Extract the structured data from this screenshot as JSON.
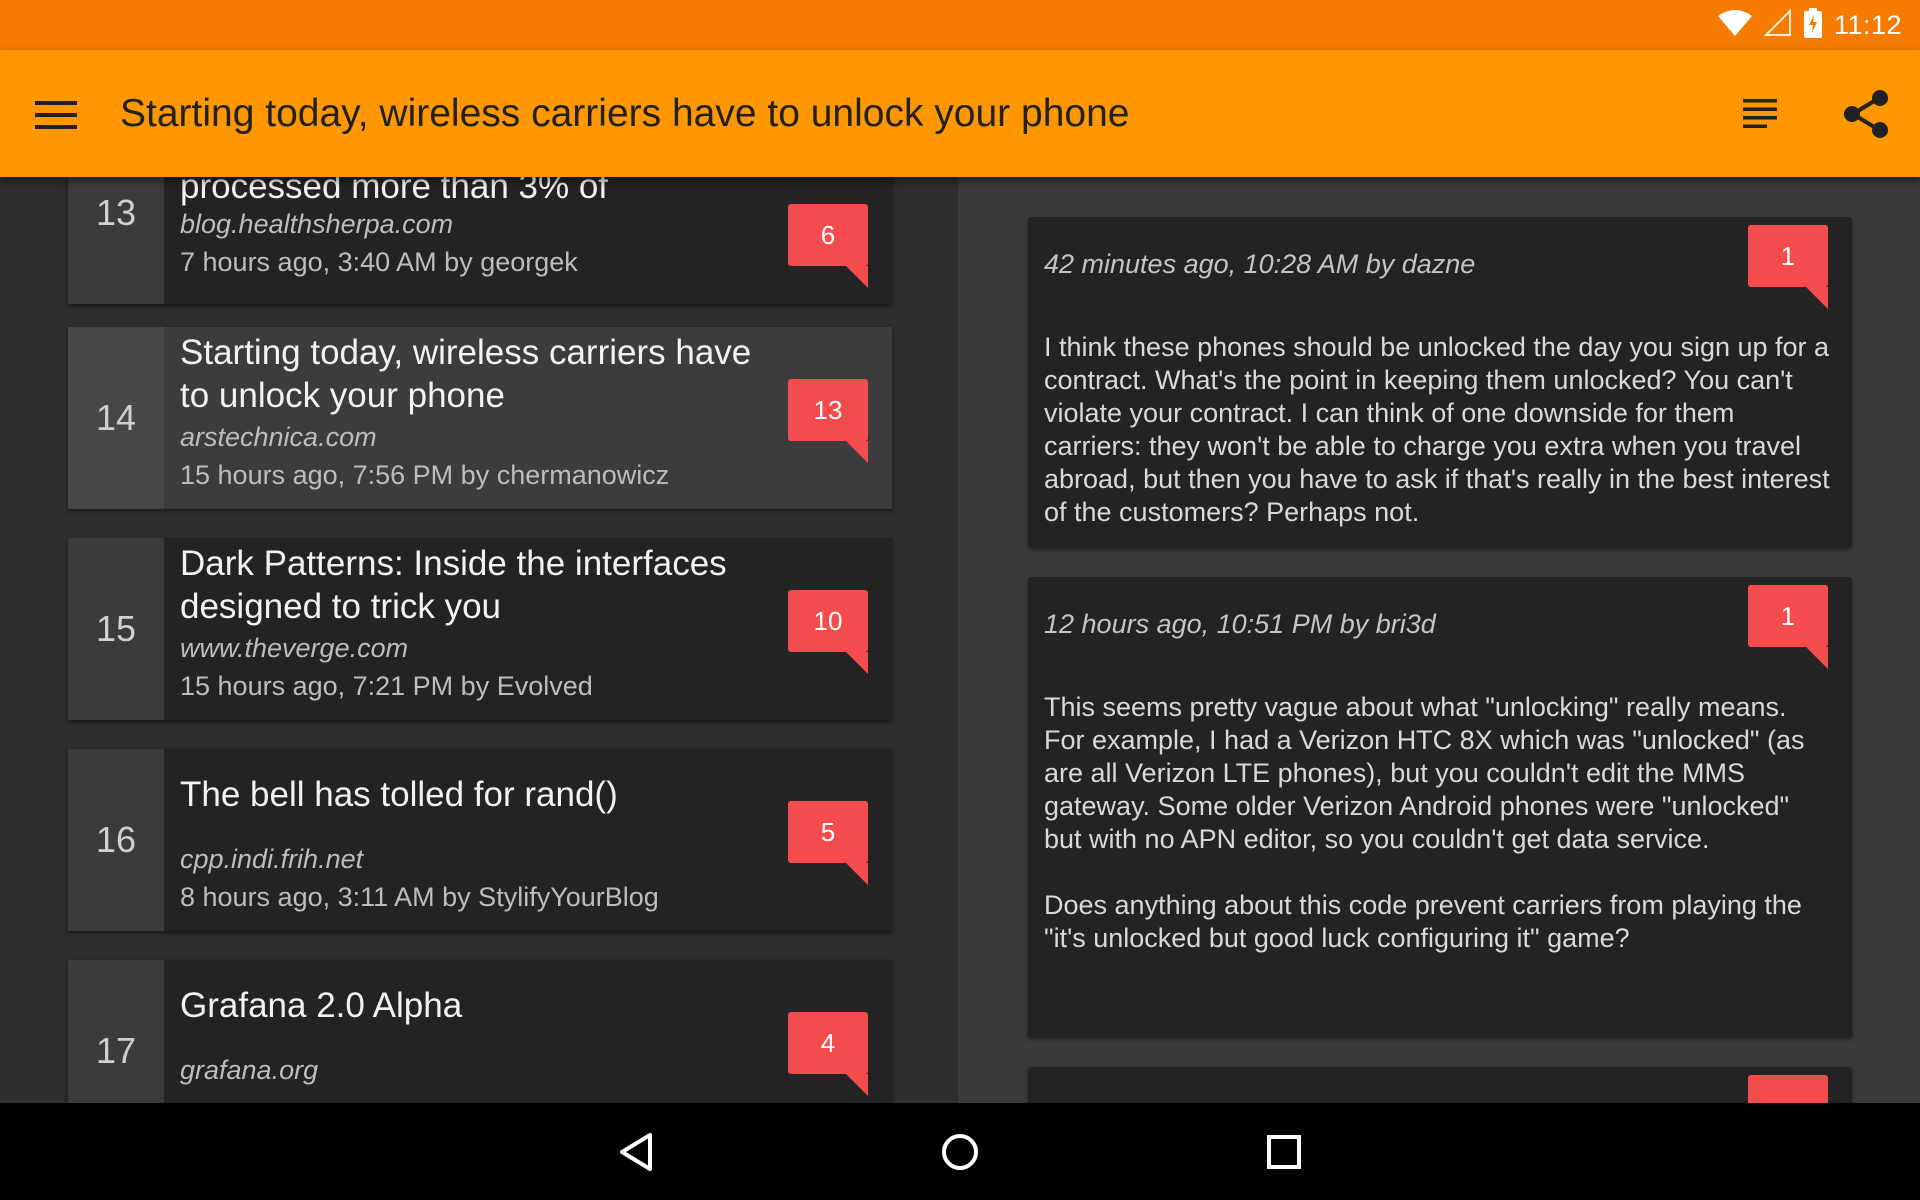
{
  "status_bar": {
    "time": "11:12",
    "icons": [
      "wifi-icon",
      "cell-signal-icon",
      "battery-charging-icon"
    ]
  },
  "app_bar": {
    "title": "Starting today, wireless carriers have to unlock your phone",
    "actions": [
      "reader-icon",
      "share-icon"
    ]
  },
  "stories": [
    {
      "rank": "13",
      "title": "processed more than 3% of",
      "domain": "blog.healthsherpa.com",
      "meta": "7 hours ago, 3:40 AM by georgek",
      "comments": "6",
      "selected": false
    },
    {
      "rank": "14",
      "title": "Starting today, wireless carriers have to unlock your phone",
      "domain": "arstechnica.com",
      "meta": "15 hours ago, 7:56 PM by chermanowicz",
      "comments": "13",
      "selected": true
    },
    {
      "rank": "15",
      "title": "Dark Patterns: Inside the interfaces designed to trick you",
      "domain": "www.theverge.com",
      "meta": "15 hours ago, 7:21 PM by Evolved",
      "comments": "10",
      "selected": false
    },
    {
      "rank": "16",
      "title": "The bell has tolled for rand()",
      "domain": "cpp.indi.frih.net",
      "meta": "8 hours ago, 3:11 AM by StylifyYourBlog",
      "comments": "5",
      "selected": false
    },
    {
      "rank": "17",
      "title": "Grafana 2.0 Alpha",
      "domain": "grafana.org",
      "meta": "",
      "comments": "4",
      "selected": false
    }
  ],
  "comments": [
    {
      "meta": "42 minutes ago, 10:28 AM by dazne",
      "replies": "1",
      "text": "I think these phones should be unlocked the day you sign up for a contract. What's the point in keeping them unlocked? You can't violate your contract. I can think of one downside for them carriers: they won't be able to charge you extra when you travel abroad, but then you have to ask if that's really in the best interest of the customers? Perhaps not."
    },
    {
      "meta": "12 hours ago, 10:51 PM by bri3d",
      "replies": "1",
      "text": "This seems pretty vague about what \"unlocking\" really means. For example, I had a Verizon HTC 8X which was \"unlocked\" (as are all Verizon LTE phones), but you couldn't edit the MMS gateway. Some older Verizon Android phones were \"unlocked\" but with no APN editor, so you couldn't get data service.\n\nDoes anything about this code prevent carriers from playing the \"it's unlocked but good luck configuring it\" game?"
    }
  ],
  "nav_bar": {
    "buttons": [
      "back-icon",
      "home-icon",
      "recents-icon"
    ]
  },
  "colors": {
    "status_bar": "#f57c00",
    "app_bar": "#ff9800",
    "badge": "#f44c4c",
    "list_bg": "#2e2e2e",
    "card_bg": "#232323"
  }
}
